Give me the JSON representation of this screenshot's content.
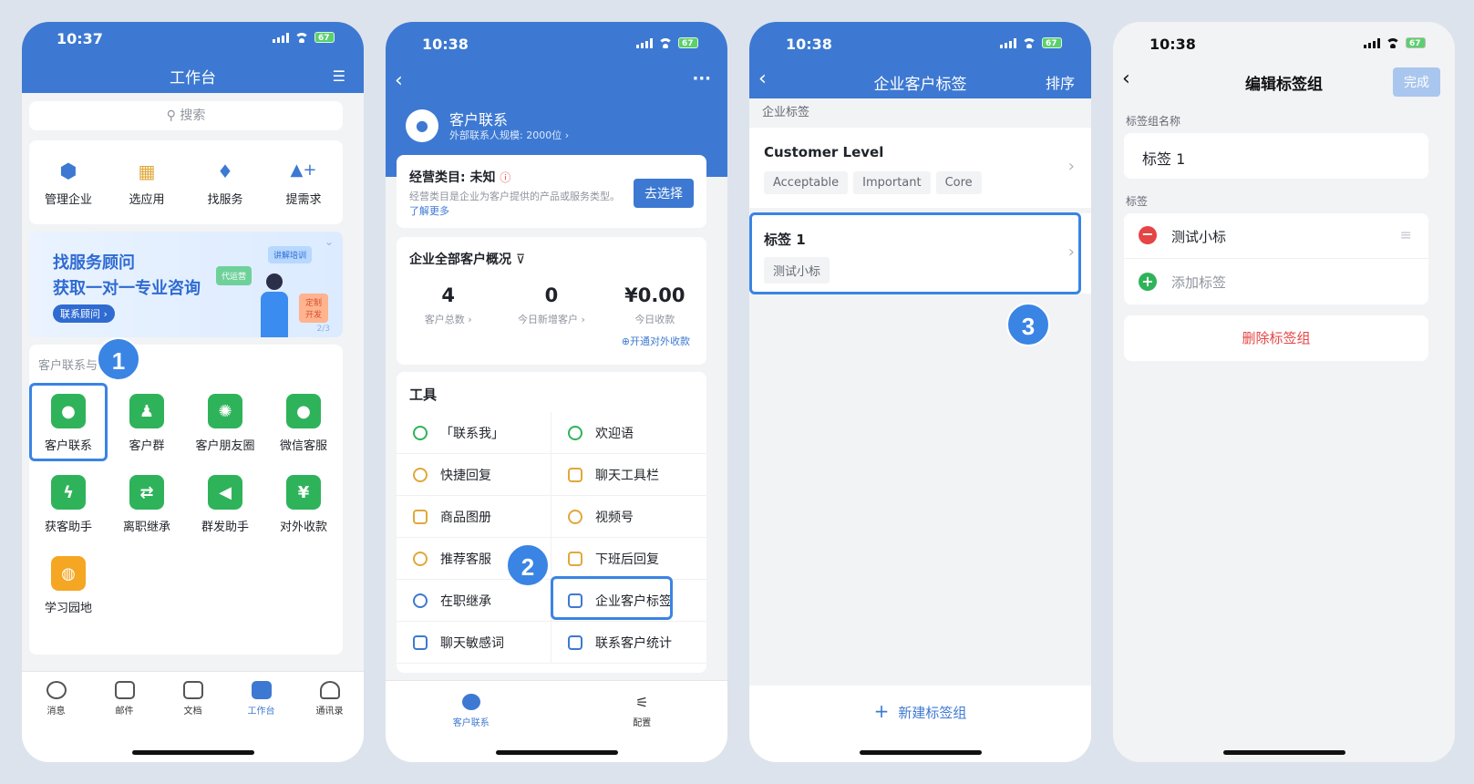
{
  "phone1": {
    "time": "10:37",
    "battery": "67",
    "title": "工作台",
    "search_placeholder": "搜索",
    "quick": [
      {
        "label": "管理企业",
        "icon": "hexagon-icon"
      },
      {
        "label": "选应用",
        "icon": "apps-grid-icon"
      },
      {
        "label": "找服务",
        "icon": "tie-icon"
      },
      {
        "label": "提需求",
        "icon": "shapes-plus-icon"
      }
    ],
    "banner": {
      "line1": "找服务顾问",
      "line2": "获取一对一专业咨询",
      "button": "联系顾问",
      "tag1": "讲解培训",
      "tag2": "代运营",
      "tag3": "定制开发",
      "page": "2/3"
    },
    "section_label": "客户联系与",
    "apps": [
      {
        "label": "客户联系",
        "icon": "chat-bubble-icon"
      },
      {
        "label": "客户群",
        "icon": "group-icon"
      },
      {
        "label": "客户朋友圈",
        "icon": "aperture-icon"
      },
      {
        "label": "微信客服",
        "icon": "service-chat-icon"
      },
      {
        "label": "获客助手",
        "icon": "lightning-icon"
      },
      {
        "label": "离职继承",
        "icon": "transfer-icon"
      },
      {
        "label": "群发助手",
        "icon": "megaphone-icon"
      },
      {
        "label": "对外收款",
        "icon": "yuan-icon"
      },
      {
        "label": "学习园地",
        "icon": "planet-icon"
      }
    ],
    "tabs": [
      {
        "label": "消息",
        "icon": "message-icon"
      },
      {
        "label": "邮件",
        "icon": "mail-icon"
      },
      {
        "label": "文档",
        "icon": "document-icon"
      },
      {
        "label": "工作台",
        "icon": "workbench-icon"
      },
      {
        "label": "通讯录",
        "icon": "contacts-icon"
      }
    ],
    "badge": "1"
  },
  "phone2": {
    "time": "10:38",
    "battery": "67",
    "title": "客户联系",
    "subtitle": "外部联系人规模: 2000位 ›",
    "category_title": "经营类目: 未知",
    "category_desc": "经营类目是企业为客户提供的产品或服务类型。",
    "learn_more": "了解更多",
    "choose_button": "去选择",
    "overview_title": "企业全部客户概况",
    "stats": [
      {
        "value": "4",
        "label": "客户总数 ›"
      },
      {
        "value": "0",
        "label": "今日新增客户 ›"
      },
      {
        "value": "¥0.00",
        "label": "今日收款"
      }
    ],
    "open_payment": "⊕开通对外收款",
    "tools_title": "工具",
    "tools": [
      "「联系我」",
      "欢迎语",
      "快捷回复",
      "聊天工具栏",
      "商品图册",
      "视频号",
      "推荐客服",
      "下班后回复",
      "在职继承",
      "企业客户标签",
      "聊天敏感词",
      "联系客户统计"
    ],
    "tabs": [
      "客户联系",
      "配置"
    ],
    "badge": "2"
  },
  "phone3": {
    "time": "10:38",
    "battery": "67",
    "title": "企业客户标签",
    "sort": "排序",
    "section": "企业标签",
    "groups": [
      {
        "name": "Customer Level",
        "tags": [
          "Acceptable",
          "Important",
          "Core"
        ]
      },
      {
        "name": "标签 1",
        "tags": [
          "测试小标"
        ]
      }
    ],
    "new_group": "新建标签组",
    "badge": "3"
  },
  "phone4": {
    "time": "10:38",
    "battery": "67",
    "title": "编辑标签组",
    "done": "完成",
    "name_label": "标签组名称",
    "name_value": "标签 1",
    "tags_label": "标签",
    "tags": [
      "测试小标"
    ],
    "add_tag": "添加标签",
    "delete_group": "删除标签组"
  }
}
